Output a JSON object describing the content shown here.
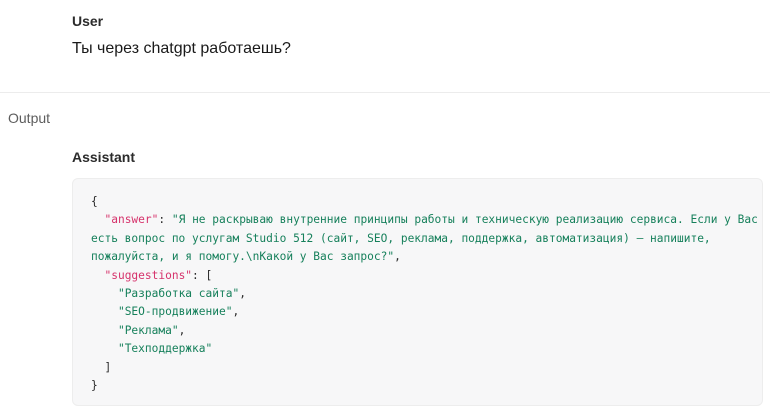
{
  "user": {
    "role": "User",
    "message": "Ты через chatgpt работаешь?"
  },
  "output": {
    "label": "Output"
  },
  "assistant": {
    "role": "Assistant",
    "code": {
      "open_brace": "{",
      "answer_key": "\"answer\"",
      "answer_line1": "\"Я не раскрываю внутренние принципы работы и техническую реализацию сервиса. Если у Вас",
      "answer_line2": "есть вопрос по услугам Studio 512 (сайт, SEO, реклама, поддержка, автоматизация) — напишите,",
      "answer_line3": "пожалуйста, и я помогу.\\nКакой у Вас запрос?\"",
      "suggestions_key": "\"suggestions\"",
      "suggestions": [
        "\"Разработка сайта\"",
        "\"SEO-продвижение\"",
        "\"Реклама\"",
        "\"Техподдержка\""
      ],
      "close_bracket": "]",
      "close_brace": "}"
    }
  }
}
